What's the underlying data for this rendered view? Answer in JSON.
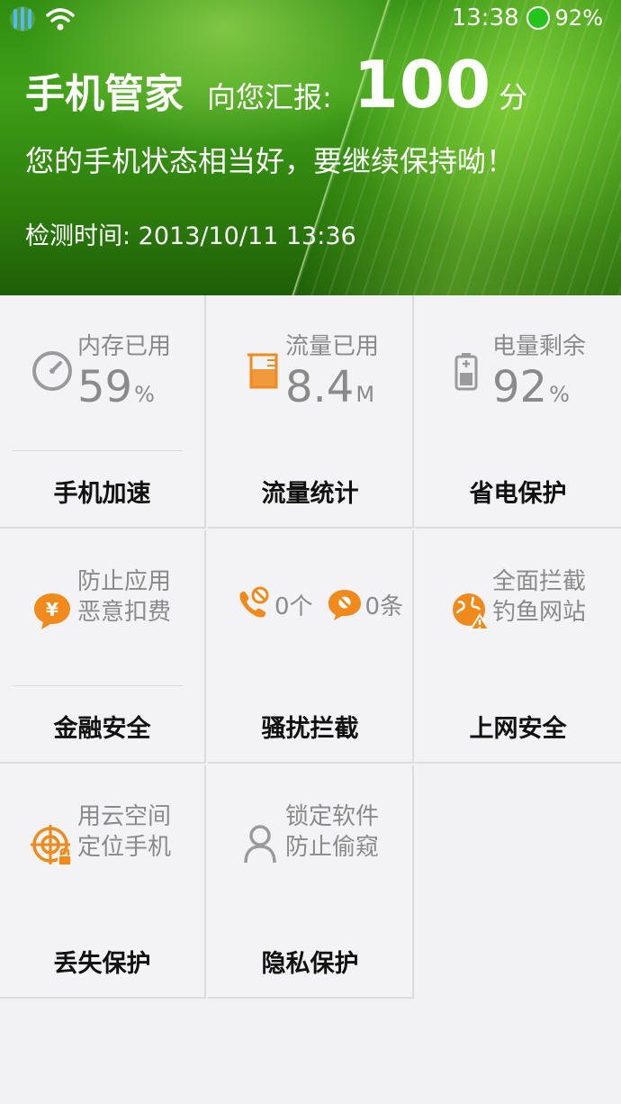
{
  "status_bar": {
    "time": "13:38",
    "battery": "92%"
  },
  "header": {
    "app_name": "手机管家",
    "report_prefix": "向您汇报:",
    "score": "100",
    "score_unit": "分",
    "message": "您的手机状态相当好，要继续保持呦！",
    "check_time": "检测时间: 2013/10/11 13:36"
  },
  "tiles": [
    {
      "icon": "speedometer-icon",
      "line1": "内存已用",
      "value": "59",
      "unit": "%",
      "label": "手机加速"
    },
    {
      "icon": "beaker-icon",
      "line1": "流量已用",
      "value": "8.4",
      "unit": "M",
      "label": "流量统计"
    },
    {
      "icon": "battery-icon",
      "line1": "电量剩余",
      "value": "92",
      "unit": "%",
      "label": "省电保护"
    },
    {
      "icon": "yuan-bubble-icon",
      "line1": "防止应用",
      "line2": "恶意扣费",
      "label": "金融安全"
    },
    {
      "icon": "blocked-call-icon",
      "calls": "0个",
      "sms": "0条",
      "label": "骚扰拦截"
    },
    {
      "icon": "globe-warning-icon",
      "line1": "全面拦截",
      "line2": "钓鱼网站",
      "label": "上网安全"
    },
    {
      "icon": "locate-lock-icon",
      "line1": "用云空间",
      "line2": "定位手机",
      "label": "丢失保护"
    },
    {
      "icon": "person-icon",
      "line1": "锁定软件",
      "line2": "防止偷窥",
      "label": "隐私保护"
    }
  ],
  "colors": {
    "accent": "#f08a1c",
    "gray_icon": "#9a9a9a",
    "header_green": "#3f9f18"
  }
}
